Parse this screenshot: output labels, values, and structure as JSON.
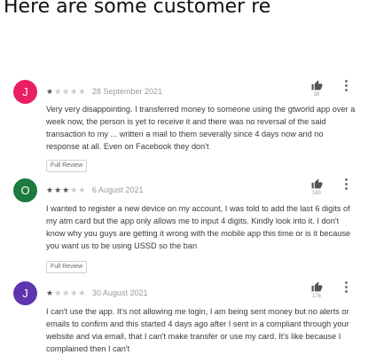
{
  "heading": "Here are some customer re",
  "reviews": [
    {
      "initial": "J",
      "avatar_color": "#e91e63",
      "rating": 1,
      "date": "28 September 2021",
      "likes": "39",
      "text": "Very very disappointing. I transferred money to someone using the gtworld app over a week now, the person is yet to receive it and there was no reversal of the said transaction to my ... written a mail to them severally since 4 days now and no response at all. Even on Facebook they don't",
      "full_review": "Full Review"
    },
    {
      "initial": "O",
      "avatar_color": "#1b7a3e",
      "rating": 3,
      "date": "6 August 2021",
      "likes": "160",
      "text": "I wanted to register a new device on my account, I was told to add the last 6 digits of my atm card but the app only allows me to input 4 digits. Kindly look into it. I don't know why you guys are getting it wrong with the mobile app this time or is it because you want us to be using USSD so the ban",
      "full_review": "Full Review"
    },
    {
      "initial": "J",
      "avatar_color": "#5e35b1",
      "rating": 1,
      "date": "30 August 2021",
      "likes": "176",
      "text": "I can't use the app. It's not allowing me login, I am being sent money but no alerts or emails to confirm and this started 4 days ago after I sent in a compliant through your website and via email, that I can't make transfer or use my card. It's like because I complained then I can't"
    }
  ],
  "icons": {
    "like": "thumbs-up-icon",
    "more": "more-vertical-icon"
  }
}
